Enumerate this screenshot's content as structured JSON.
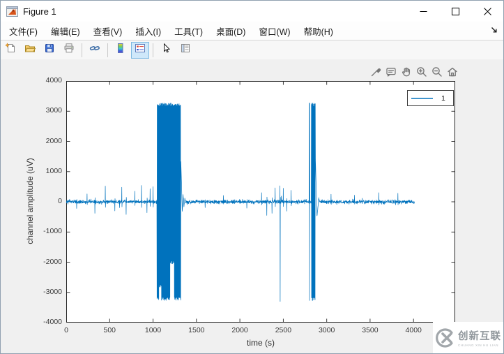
{
  "window": {
    "title": "Figure 1"
  },
  "menu": {
    "items": [
      {
        "name": "file",
        "label": "文件(F)"
      },
      {
        "name": "edit",
        "label": "编辑(E)"
      },
      {
        "name": "view",
        "label": "查看(V)"
      },
      {
        "name": "insert",
        "label": "插入(I)"
      },
      {
        "name": "tools",
        "label": "工具(T)"
      },
      {
        "name": "desktop",
        "label": "桌面(D)"
      },
      {
        "name": "window",
        "label": "窗口(W)"
      },
      {
        "name": "help",
        "label": "帮助(H)"
      }
    ]
  },
  "toolbar": {
    "buttons": [
      {
        "name": "new-figure",
        "group": 1,
        "selected": false
      },
      {
        "name": "open-file",
        "group": 1,
        "selected": false
      },
      {
        "name": "save-figure",
        "group": 1,
        "selected": false
      },
      {
        "name": "print-figure",
        "group": 1,
        "selected": false
      },
      {
        "name": "link-plot",
        "group": 2,
        "selected": false
      },
      {
        "name": "insert-colorbar",
        "group": 3,
        "selected": false
      },
      {
        "name": "insert-legend",
        "group": 3,
        "selected": true
      },
      {
        "name": "edit-plot",
        "group": 4,
        "selected": false
      },
      {
        "name": "property-editor",
        "group": 4,
        "selected": false
      }
    ]
  },
  "axes_toolbar": {
    "buttons": [
      "brush",
      "datatips",
      "pan",
      "zoom-in",
      "zoom-out",
      "restore-view"
    ]
  },
  "legend": {
    "entries": [
      {
        "label": "1",
        "color": "#0072BD"
      }
    ]
  },
  "watermark": {
    "name": "创新互联",
    "caption": "CHUANG XIN HU LIAN"
  },
  "colors": {
    "trace": "#0072BD",
    "axis": "#262626",
    "figure_bg": "#f0f0f0",
    "selected_tool_bg": "#cfe8fa",
    "selected_tool_border": "#7db8e2"
  },
  "chart_data": {
    "type": "line",
    "title": "",
    "xlabel": "time (s)",
    "ylabel": "channel amplitude (uV)",
    "xlim": [
      0,
      4480
    ],
    "ylim": [
      -4000,
      4000
    ],
    "xticks": [
      0,
      500,
      1000,
      1500,
      2000,
      2500,
      3000,
      3500,
      4000
    ],
    "yticks": [
      -4000,
      -3000,
      -2000,
      -1000,
      0,
      1000,
      2000,
      3000,
      4000
    ],
    "grid": false,
    "box": true,
    "legend_position": "northeast",
    "series": [
      {
        "name": "1",
        "color": "#0072BD"
      }
    ],
    "signal": {
      "description": "Single-channel EEG-like trace: baseline noise ~±100 uV with intermittent artifact spikes; saturated artifact bursts (~±3270 uV) at ~1045-1318 s and ~2824-2868 s with a thin full-scale line at ~2800 s; isolated full-scale negative spike at ~2464 s; damped recovery transients after each burst; recording ends ~4010 s",
      "duration": 4010,
      "sample_interval": 2,
      "noise_sigma": 30,
      "spike_prob": 0.02,
      "spikes": [
        {
          "t": 120,
          "amp": -220
        },
        {
          "t": 240,
          "amp": 260
        },
        {
          "t": 330,
          "amp": -380
        },
        {
          "t": 450,
          "amp": 520
        },
        {
          "t": 560,
          "amp": -300
        },
        {
          "t": 640,
          "amp": 480
        },
        {
          "t": 690,
          "amp": -420
        },
        {
          "t": 790,
          "amp": 350
        },
        {
          "t": 866,
          "amp": 540
        },
        {
          "t": 930,
          "amp": -360
        },
        {
          "t": 965,
          "amp": 430
        },
        {
          "t": 1000,
          "amp": 500
        },
        {
          "t": 1600,
          "amp": -190
        },
        {
          "t": 1810,
          "amp": 210
        },
        {
          "t": 2080,
          "amp": -210
        },
        {
          "t": 2250,
          "amp": 300
        },
        {
          "t": 2310,
          "amp": -450
        },
        {
          "t": 2370,
          "amp": -380
        },
        {
          "t": 2405,
          "amp": 460
        },
        {
          "t": 2500,
          "amp": 450
        },
        {
          "t": 2540,
          "amp": -310
        },
        {
          "t": 2590,
          "amp": 380
        },
        {
          "t": 3050,
          "amp": 250
        },
        {
          "t": 3320,
          "amp": 220
        },
        {
          "t": 3600,
          "amp": 300
        },
        {
          "t": 3820,
          "amp": 280
        }
      ],
      "impulses": [
        {
          "t": 2462,
          "values": [
            530,
            -3300,
            150
          ]
        },
        {
          "t": 2800,
          "values": [
            3270,
            -3270,
            3270
          ]
        }
      ],
      "transients": [
        {
          "points": [
            [
              1320,
              1340
            ],
            [
              1328,
              620
            ],
            [
              1336,
              -330
            ],
            [
              1346,
              240
            ],
            [
              1356,
              -140
            ],
            [
              1366,
              80
            ],
            [
              1376,
              0
            ]
          ]
        },
        {
          "points": [
            [
              2870,
              1400
            ],
            [
              2878,
              520
            ],
            [
              2888,
              -460
            ],
            [
              2898,
              -210
            ],
            [
              2908,
              120
            ],
            [
              2918,
              0
            ]
          ]
        }
      ],
      "bursts": [
        {
          "t0": 1045,
          "t1": 1318,
          "top": 3270,
          "bottom": -3270,
          "notches": [
            {
              "t0": 1068,
              "t1": 1096,
              "bottom": -2830
            },
            {
              "t0": 1198,
              "t1": 1242,
              "bottom": -2060
            }
          ]
        },
        {
          "t0": 2824,
          "t1": 2868,
          "top": 3270,
          "bottom": -3270,
          "notches": []
        }
      ]
    }
  }
}
